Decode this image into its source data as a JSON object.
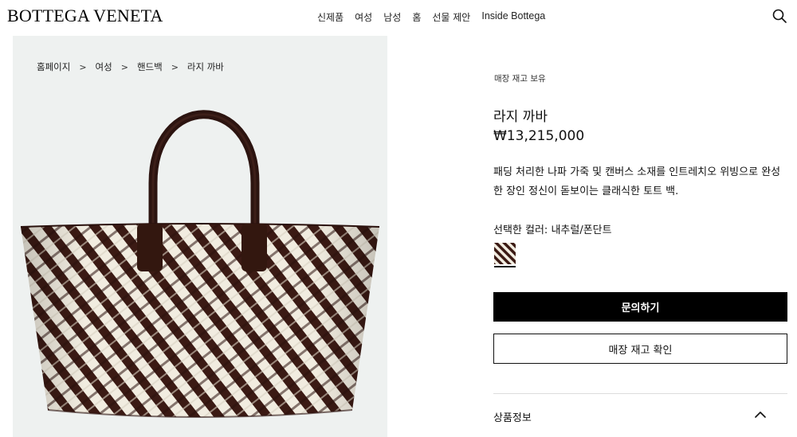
{
  "header": {
    "logo": "BOTTEGA VENETA",
    "nav": [
      "신제품",
      "여성",
      "남성",
      "홈",
      "선물 제안",
      "Inside Bottega"
    ],
    "search_icon": "search-icon"
  },
  "breadcrumb": [
    "홈페이지",
    "여성",
    "핸드백",
    "라지 까바"
  ],
  "breadcrumb_separator": ">",
  "product": {
    "stock_note": "매장 재고 보유",
    "name": "라지 까바",
    "price": "₩13,215,000",
    "description": "패딩 처리한 나파 가죽 및 캔버스 소재를 인트레치오 위빙으로 완성한 장인 정신이 돋보이는 클래식한 토트 백.",
    "color_label": "선택한 컬러: 내추럴/폰단트",
    "swatch_colors": [
      "#3b1a14",
      "#f1ece0"
    ]
  },
  "actions": {
    "inquire": "문의하기",
    "check_stock": "매장 재고 확인"
  },
  "accordion": {
    "label": "상품정보",
    "icon": "chevron-up-icon"
  },
  "colors": {
    "image_background": "#eef1f0",
    "bag_dark": "#3b1a14",
    "bag_light": "#f1ece0",
    "button_primary": "#000000"
  }
}
